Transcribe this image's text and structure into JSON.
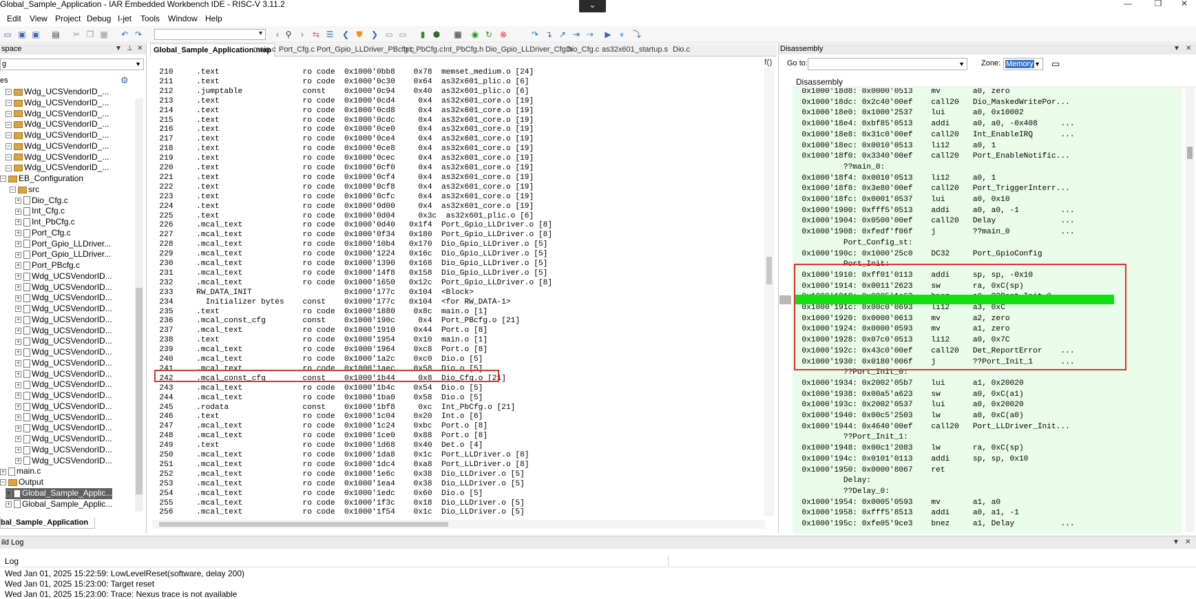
{
  "title": "Global_Sample_Application - IAR Embedded Workbench IDE - RISC-V 3.11.2",
  "window_controls": {
    "collapse": "⌄",
    "minimize": "—",
    "maximize": "❐",
    "close": "✕"
  },
  "menu": [
    "Edit",
    "View",
    "Project",
    "Debug",
    "I-jet",
    "Tools",
    "Window",
    "Help"
  ],
  "toolbar": {
    "search_value": ""
  },
  "workspace": {
    "header": "space",
    "config": "g",
    "files_label": "es",
    "tree": [
      {
        "indent": 0,
        "type": "folder",
        "label": "Wdg_UCSVendorID_..."
      },
      {
        "indent": 0,
        "type": "folder",
        "label": "Wdg_UCSVendorID_..."
      },
      {
        "indent": 0,
        "type": "folder",
        "label": "Wdg_UCSVendorID_..."
      },
      {
        "indent": 0,
        "type": "folder",
        "label": "Wdg_UCSVendorID_..."
      },
      {
        "indent": 0,
        "type": "folder",
        "label": "Wdg_UCSVendorID_..."
      },
      {
        "indent": 0,
        "type": "folder",
        "label": "Wdg_UCSVendorID_..."
      },
      {
        "indent": 0,
        "type": "folder",
        "label": "Wdg_UCSVendorID_..."
      },
      {
        "indent": 0,
        "type": "folder",
        "label": "Wdg_UCSVendorID_..."
      },
      {
        "indent": -1,
        "type": "folder",
        "label": "EB_Configuration"
      },
      {
        "indent": 1,
        "type": "folder",
        "label": "src"
      },
      {
        "indent": 2,
        "type": "file",
        "label": "Dio_Cfg.c"
      },
      {
        "indent": 2,
        "type": "file",
        "label": "Int_Cfg.c"
      },
      {
        "indent": 2,
        "type": "file",
        "label": "Int_PbCfg.c"
      },
      {
        "indent": 2,
        "type": "file",
        "label": "Port_Cfg.c"
      },
      {
        "indent": 2,
        "type": "file",
        "label": "Port_Gpio_LLDriver..."
      },
      {
        "indent": 2,
        "type": "file",
        "label": "Port_Gpio_LLDriver..."
      },
      {
        "indent": 2,
        "type": "file",
        "label": "Port_PBcfg.c"
      },
      {
        "indent": 2,
        "type": "file",
        "label": "Wdg_UCSVendorID..."
      },
      {
        "indent": 2,
        "type": "file",
        "label": "Wdg_UCSVendorID..."
      },
      {
        "indent": 2,
        "type": "file",
        "label": "Wdg_UCSVendorID..."
      },
      {
        "indent": 2,
        "type": "file",
        "label": "Wdg_UCSVendorID..."
      },
      {
        "indent": 2,
        "type": "file",
        "label": "Wdg_UCSVendorID..."
      },
      {
        "indent": 2,
        "type": "file",
        "label": "Wdg_UCSVendorID..."
      },
      {
        "indent": 2,
        "type": "file",
        "label": "Wdg_UCSVendorID..."
      },
      {
        "indent": 2,
        "type": "file",
        "label": "Wdg_UCSVendorID..."
      },
      {
        "indent": 2,
        "type": "file",
        "label": "Wdg_UCSVendorID..."
      },
      {
        "indent": 2,
        "type": "file",
        "label": "Wdg_UCSVendorID..."
      },
      {
        "indent": 2,
        "type": "file",
        "label": "Wdg_UCSVendorID..."
      },
      {
        "indent": 2,
        "type": "file",
        "label": "Wdg_UCSVendorID..."
      },
      {
        "indent": 2,
        "type": "file",
        "label": "Wdg_UCSVendorID..."
      },
      {
        "indent": 2,
        "type": "file",
        "label": "Wdg_UCSVendorID..."
      },
      {
        "indent": 2,
        "type": "file",
        "label": "Wdg_UCSVendorID..."
      },
      {
        "indent": 2,
        "type": "file",
        "label": "Wdg_UCSVendorID..."
      },
      {
        "indent": 2,
        "type": "file",
        "label": "Wdg_UCSVendorID..."
      },
      {
        "indent": 2,
        "type": "file",
        "label": "Wdg_UCSVendorID..."
      },
      {
        "indent": -1,
        "type": "file",
        "label": "main.c"
      },
      {
        "indent": -1,
        "type": "folder",
        "label": "Output"
      },
      {
        "indent": 0,
        "type": "file",
        "label": "Global_Sample_Applic...",
        "selected": true
      },
      {
        "indent": 0,
        "type": "file",
        "label": "Global_Sample_Applic..."
      }
    ],
    "tab": "bal_Sample_Application"
  },
  "editor": {
    "tabs": [
      {
        "label": "Global_Sample_Application.map",
        "active": true
      },
      {
        "label": "main.c"
      },
      {
        "label": "Port_Cfg.c"
      },
      {
        "label": "Port_Gpio_LLDriver_PBcfg.c"
      },
      {
        "label": "Int_PbCfg.c"
      },
      {
        "label": "Int_PbCfg.h"
      },
      {
        "label": "Dio_Gpio_LLDriver_Cfg.h"
      },
      {
        "label": "Dio_Cfg.c"
      },
      {
        "label": "as32x601_startup.s"
      },
      {
        "label": "Dio.c"
      }
    ],
    "lines": [
      "  210     .text                  ro code  0x1000'0bb8    0x78  memset_medium.o [24]",
      "  211     .text                  ro code  0x1000'0c30    0x64  as32x601_plic.o [6]",
      "  212     .jumptable             const    0x1000'0c94    0x40  as32x601_plic.o [6]",
      "  213     .text                  ro code  0x1000'0cd4     0x4  as32x601_core.o [19]",
      "  214     .text                  ro code  0x1000'0cd8     0x4  as32x601_core.o [19]",
      "  215     .text                  ro code  0x1000'0cdc     0x4  as32x601_core.o [19]",
      "  216     .text                  ro code  0x1000'0ce0     0x4  as32x601_core.o [19]",
      "  217     .text                  ro code  0x1000'0ce4     0x4  as32x601_core.o [19]",
      "  218     .text                  ro code  0x1000'0ce8     0x4  as32x601_core.o [19]",
      "  219     .text                  ro code  0x1000'0cec     0x4  as32x601_core.o [19]",
      "  220     .text                  ro code  0x1000'0cf0     0x4  as32x601_core.o [19]",
      "  221     .text                  ro code  0x1000'0cf4     0x4  as32x601_core.o [19]",
      "  222     .text                  ro code  0x1000'0cf8     0x4  as32x601_core.o [19]",
      "  223     .text                  ro code  0x1000'0cfc     0x4  as32x601_core.o [19]",
      "  224     .text                  ro code  0x1000'0d00     0x4  as32x601_core.o [19]",
      "  225     .text                  ro code  0x1000'0d04     0x3c  as32x601_plic.o [6]",
      "  226     .mcal_text             ro code  0x1000'0d40   0x1f4  Port_Gpio_LLDriver.o [8]",
      "  227     .mcal_text             ro code  0x1000'0f34   0x180  Port_Gpio_LLDriver.o [8]",
      "  228     .mcal_text             ro code  0x1000'10b4   0x170  Dio_Gpio_LLDriver.o [5]",
      "  229     .mcal_text             ro code  0x1000'1224   0x16c  Dio_Gpio_LLDriver.o [5]",
      "  230     .mcal_text             ro code  0x1000'1390   0x168  Dio_Gpio_LLDriver.o [5]",
      "  231     .mcal_text             ro code  0x1000'14f8   0x158  Dio_Gpio_LLDriver.o [5]",
      "  232     .mcal_text             ro code  0x1000'1650   0x12c  Port_Gpio_LLDriver.o [8]",
      "  233     RW_DATA_INIT                    0x1000'177c   0x104  <Block>",
      "  234       Initializer bytes    const    0x1000'177c   0x104  <for RW_DATA-1>",
      "  235     .text                  ro code  0x1000'1880    0x8c  main.o [1]",
      "  236     .mcal_const_cfg        const    0x1000'190c     0x4  Port_PBcfg.o [21]",
      "  237     .mcal_text             ro code  0x1000'1910    0x44  Port.o [8]",
      "  238     .text                  ro code  0x1000'1954    0x10  main.o [1]",
      "  239     .mcal_text             ro code  0x1000'1964    0xc8  Port.o [8]",
      "  240     .mcal_text             ro code  0x1000'1a2c    0xc0  Dio.o [5]",
      "  241     .mcal_text             ro code  0x1000'1aec    0x58  Dio.o [5]",
      "  242     .mcal_const_cfg        const    0x1000'1b44     0x8  Dio_Cfg.o [21]",
      "  243     .mcal_text             ro code  0x1000'1b4c    0x54  Dio.o [5]",
      "  244     .mcal_text             ro code  0x1000'1ba0    0x58  Dio.o [5]",
      "  245     .rodata                const    0x1000'1bf8     0xc  Int_PbCfg.o [21]",
      "  246     .text                  ro code  0x1000'1c04    0x20  Int.o [6]",
      "  247     .mcal_text             ro code  0x1000'1c24    0xbc  Port.o [8]",
      "  248     .mcal_text             ro code  0x1000'1ce0    0x88  Port.o [8]",
      "  249     .text                  ro code  0x1000'1d68    0x40  Det.o [4]",
      "  250     .mcal_text             ro code  0x1000'1da8    0x1c  Port_LLDriver.o [8]",
      "  251     .mcal_text             ro code  0x1000'1dc4    0xa8  Port_LLDriver.o [8]",
      "  252     .mcal_text             ro code  0x1000'1e6c    0x38  Dio_LLDriver.o [5]",
      "  253     .mcal_text             ro code  0x1000'1ea4    0x38  Dio_LLDriver.o [5]",
      "  254     .mcal_text             ro code  0x1000'1edc    0x60  Dio.o [5]",
      "  255     .mcal_text             ro code  0x1000'1f3c    0x18  Dio_LLDriver.o [5]",
      "  256     .mcal_text             ro code  0x1000'1f54    0x1c  Dio_LLDriver.o [5]"
    ]
  },
  "disassembly": {
    "header": "Disassembly",
    "goto_label": "Go to:",
    "goto_value": "",
    "zone_label": "Zone:",
    "zone_value": "Memory",
    "section_title": "Disassembly",
    "lines": [
      "  0x1000'18d8: 0x0000'0513    mv       a0, zero",
      "  0x1000'18dc: 0x2c40'00ef    call20   Dio_MaskedWritePor...",
      "  0x1000'18e0: 0x1000'2537    lui      a0, 0x10002",
      "  0x1000'18e4: 0xbf85'0513    addi     a0, a0, -0x408     ...",
      "  0x1000'18e8: 0x31c0'00ef    call20   Int_EnableIRQ      ...",
      "  0x1000'18ec: 0x0010'0513    li12     a0, 1",
      "  0x1000'18f0: 0x3340'00ef    call20   Port_EnableNotific...",
      "           ??main_0:",
      "  0x1000'18f4: 0x0010'0513    li12     a0, 1",
      "  0x1000'18f8: 0x3e80'00ef    call20   Port_TriggerInterr...",
      "  0x1000'18fc: 0x0001'0537    lui      a0, 0x10",
      "  0x1000'1900: 0xfff5'0513    addi     a0, a0, -1         ...",
      "  0x1000'1904: 0x0500'00ef    call20   Delay              ...",
      "  0x1000'1908: 0xfedf'f06f    j        ??main_0           ...",
      "           Port_Config_st:",
      "  0x1000'190c: 0x1000'25c0    DC32     Port_GpioConfig",
      "           Port_Init:",
      "  0x1000'1910: 0xff01'0113    addi     sp, sp, -0x10",
      "  0x1000'1914: 0x0011'2623    sw       ra, 0xC(sp)",
      "  0x1000'1918: 0x0005'1e63    bnez     a0, ??Port_Init_0  ...",
      "  0x1000'191c: 0x00c0'0693    li12     a3, 0xC",
      "  0x1000'1920: 0x0000'0613    mv       a2, zero",
      "  0x1000'1924: 0x0000'0593    mv       a1, zero",
      "  0x1000'1928: 0x07c0'0513    li12     a0, 0x7C",
      "  0x1000'192c: 0x43c0'00ef    call20   Det_ReportError    ...",
      "  0x1000'1930: 0x0180'006f    j        ??Port_Init_1      ...",
      "           ??Port_Init_0:",
      "  0x1000'1934: 0x2002'05b7    lui      a1, 0x20020",
      "  0x1000'1938: 0x00a5'a623    sw       a0, 0xC(a1)",
      "  0x1000'193c: 0x2002'0537    lui      a0, 0x20020",
      "  0x1000'1940: 0x00c5'2503    lw       a0, 0xC(a0)",
      "  0x1000'1944: 0x4640'00ef    call20   Port_LLDriver_Init...",
      "           ??Port_Init_1:",
      "  0x1000'1948: 0x00c1'2083    lw       ra, 0xC(sp)",
      "  0x1000'194c: 0x0101'0113    addi     sp, sp, 0x10",
      "  0x1000'1950: 0x0000'8067    ret",
      "           Delay:",
      "           ??Delay_0:",
      "  0x1000'1954: 0x0005'0593    mv       a1, a0",
      "  0x1000'1958: 0xfff5'8513    addi     a0, a1, -1",
      "  0x1000'195c: 0xfe05'9ce3    bnez     a1, Delay          ..."
    ]
  },
  "build_log": {
    "header": "ild Log",
    "column": "Log",
    "lines": [
      "Wed Jan 01, 2025 15:22:59: LowLevelReset(software, delay 200)",
      "Wed Jan 01, 2025 15:23:00: Target reset",
      "Wed Jan 01, 2025 15:23:00: Trace: Nexus trace is not available"
    ]
  }
}
